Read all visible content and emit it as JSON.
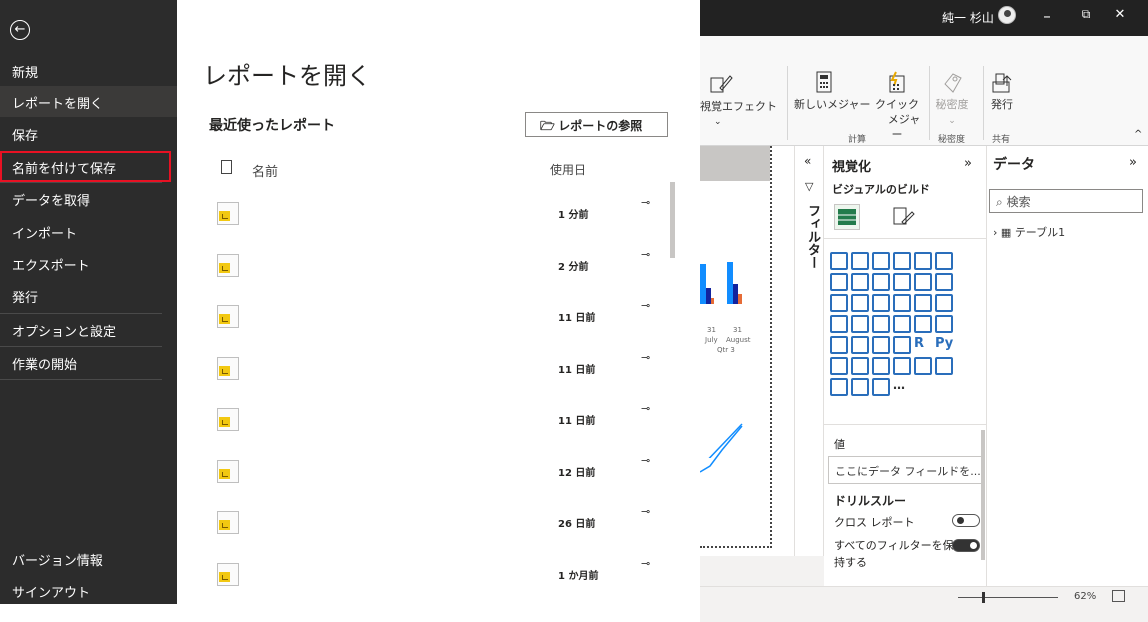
{
  "titlebar": {
    "user": "純一 杉山",
    "minimize": "–",
    "restore": "⧉",
    "close": "✕"
  },
  "sidebar": {
    "back": "←",
    "items": [
      {
        "label": "新規"
      },
      {
        "label": "レポートを開く"
      },
      {
        "label": "保存"
      },
      {
        "label": "名前を付けて保存"
      },
      {
        "label": "データを取得"
      },
      {
        "label": "インポート"
      },
      {
        "label": "エクスポート"
      },
      {
        "label": "発行"
      },
      {
        "label": "オプションと設定"
      },
      {
        "label": "作業の開始"
      }
    ],
    "bottom": [
      {
        "label": "バージョン情報"
      },
      {
        "label": "サインアウト"
      }
    ]
  },
  "main": {
    "title": "レポートを開く",
    "recent_heading": "最近使ったレポート",
    "browse_button": "レポートの参照",
    "col_name": "名前",
    "col_date": "使用日",
    "rows": [
      {
        "when": "1 分前"
      },
      {
        "when": "2 分前"
      },
      {
        "when": "11 日前"
      },
      {
        "when": "11 日前"
      },
      {
        "when": "11 日前"
      },
      {
        "when": "12 日前"
      },
      {
        "when": "26 日前"
      },
      {
        "when": "1 か月前"
      }
    ]
  },
  "ribbon": {
    "visual_effects": "視覚エフェクト",
    "new_measure": "新しいメジャー",
    "quick_measure_1": "クイック",
    "quick_measure_2": "メジャー",
    "sensitivity": "秘密度",
    "publish": "発行",
    "group_calc": "計算",
    "group_sensitivity": "秘密度",
    "group_share": "共有"
  },
  "canvas": {
    "axis_labels": [
      "31",
      "31",
      "July",
      "August",
      "Qtr 3"
    ]
  },
  "filters": {
    "label": "フィルター"
  },
  "viz": {
    "title": "視覚化",
    "subtitle": "ビジュアルのビルド",
    "value_label": "値",
    "field_placeholder": "ここにデータ フィールドを...",
    "drillthrough": "ドリルスルー",
    "cross_report": "クロス レポート",
    "keep_filters": "すべてのフィルターを保持する"
  },
  "data_pane": {
    "title": "データ",
    "search_placeholder": "検索",
    "table_name": "テーブル1"
  },
  "status": {
    "zoom": "62%"
  }
}
